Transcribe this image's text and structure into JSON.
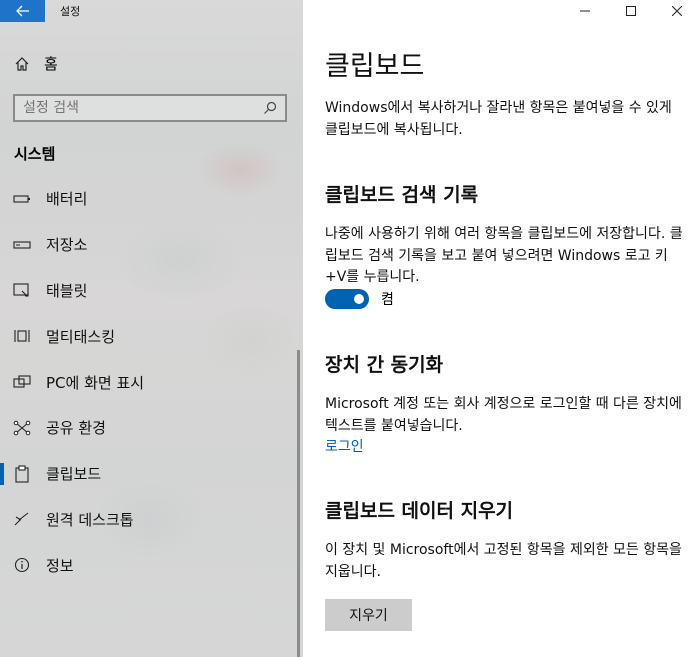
{
  "window": {
    "title": "설정"
  },
  "sidebar": {
    "home_label": "홈",
    "search_placeholder": "설정 검색",
    "section": "시스템",
    "items": [
      {
        "label": "배터리",
        "icon": "battery-icon"
      },
      {
        "label": "저장소",
        "icon": "storage-icon"
      },
      {
        "label": "태블릿",
        "icon": "tablet-icon"
      },
      {
        "label": "멀티태스킹",
        "icon": "multitasking-icon"
      },
      {
        "label": "PC에 화면 표시",
        "icon": "project-icon"
      },
      {
        "label": "공유 환경",
        "icon": "shared-icon"
      },
      {
        "label": "클립보드",
        "icon": "clipboard-icon",
        "active": true
      },
      {
        "label": "원격 데스크톱",
        "icon": "remote-desktop-icon"
      },
      {
        "label": "정보",
        "icon": "info-icon"
      }
    ]
  },
  "main": {
    "title": "클립보드",
    "intro": "Windows에서 복사하거나 잘라낸 항목은 붙여넣을 수 있게 클립보드에 복사됩니다.",
    "history": {
      "heading": "클립보드 검색 기록",
      "desc": "나중에 사용하기 위해 여러 항목을 클립보드에 저장합니다. 클립보드 검색 기록을 보고 붙여 넣으려면 Windows 로고 키+V를 누릅니다.",
      "toggle_state": "켬"
    },
    "sync": {
      "heading": "장치 간 동기화",
      "desc": "Microsoft 계정 또는 회사 계정으로 로그인할 때 다른 장치에 텍스트를 붙여넣습니다.",
      "link": "로그인"
    },
    "clear": {
      "heading": "클립보드 데이터 지우기",
      "desc": "이 장치 및 Microsoft에서 고정된 항목을 제외한 모든 항목을 지웁니다.",
      "button": "지우기"
    }
  },
  "colors": {
    "accent": "#0063b1",
    "titlebar_back": "#1f74c9"
  }
}
